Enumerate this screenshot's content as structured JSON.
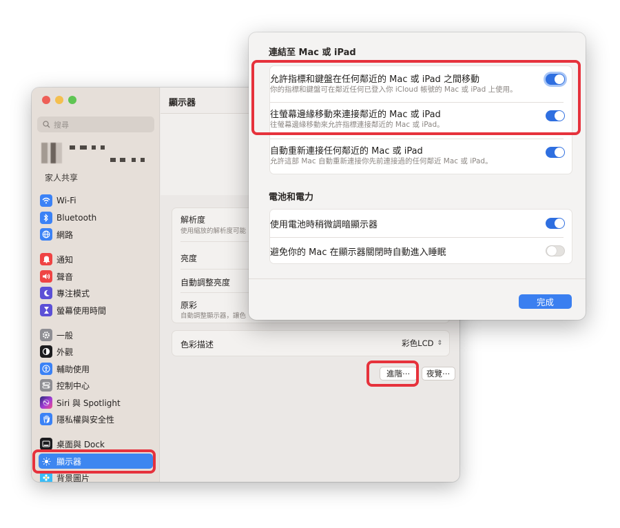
{
  "window": {
    "title": "顯示器",
    "search_placeholder": "搜尋",
    "family_label": "家人共享",
    "sidebar": [
      {
        "label": "Wi-Fi",
        "icon": "wifi-icon",
        "color": "#3b82f6"
      },
      {
        "label": "Bluetooth",
        "icon": "bluetooth-icon",
        "color": "#3b82f6"
      },
      {
        "label": "網路",
        "icon": "globe-icon",
        "color": "#3b82f6"
      },
      {
        "label": "通知",
        "icon": "bell-icon",
        "color": "#ef4444"
      },
      {
        "label": "聲音",
        "icon": "speaker-icon",
        "color": "#ef4444"
      },
      {
        "label": "專注模式",
        "icon": "moon-icon",
        "color": "#5b50d6"
      },
      {
        "label": "螢幕使用時間",
        "icon": "hourglass-icon",
        "color": "#5b50d6"
      },
      {
        "label": "一般",
        "icon": "gear-icon",
        "color": "#8e8e93"
      },
      {
        "label": "外觀",
        "icon": "appearance-icon",
        "color": "#1c1c1e"
      },
      {
        "label": "輔助使用",
        "icon": "accessibility-icon",
        "color": "#3b82f6"
      },
      {
        "label": "控制中心",
        "icon": "control-center-icon",
        "color": "#8e8e93"
      },
      {
        "label": "Siri 與 Spotlight",
        "icon": "siri-icon",
        "color": "#7c3aed"
      },
      {
        "label": "隱私權與安全性",
        "icon": "hand-icon",
        "color": "#3b82f6"
      },
      {
        "label": "桌面與 Dock",
        "icon": "dock-icon",
        "color": "#1c1c1e"
      },
      {
        "label": "顯示器",
        "icon": "sun-icon",
        "color": "#3b82f6",
        "selected": true
      },
      {
        "label": "背景圖片",
        "icon": "wallpaper-icon",
        "color": "#38bdf8"
      }
    ],
    "settings": {
      "resolution_label": "解析度",
      "resolution_sub": "使用縮放的解析度可能",
      "brightness_label": "亮度",
      "auto_brightness_label": "自動調整亮度",
      "true_tone_label": "原彩",
      "true_tone_sub": "自動調整顯示器，讓色",
      "color_profile_label": "色彩描述",
      "color_profile_value": "彩色LCD",
      "advanced_button": "進階⋯",
      "night_shift_button": "夜覽⋯"
    }
  },
  "sheet": {
    "section1_title": "連結至 Mac 或 iPad",
    "options1": [
      {
        "label": "允許指標和鍵盤在任何鄰近的 Mac 或 iPad 之間移動",
        "sub": "你的指標和鍵盤可在鄰近任何已登入你 iCloud 帳號的 Mac 或 iPad 上使用。",
        "on": true
      },
      {
        "label": "往螢幕邊緣移動來連接鄰近的 Mac 或 iPad",
        "sub": "往螢幕邊緣移動來允許指標連接鄰近的 Mac 或 iPad。",
        "on": true
      },
      {
        "label": "自動重新連接任何鄰近的 Mac 或 iPad",
        "sub": "允許這部 Mac 自動重新連接你先前連接過的任何鄰近 Mac 或 iPad。",
        "on": true
      }
    ],
    "section2_title": "電池和電力",
    "options2": [
      {
        "label": "使用電池時稍微調暗顯示器",
        "on": true
      },
      {
        "label": "避免你的 Mac 在顯示器關閉時自動進入睡眠",
        "on": false
      }
    ],
    "done_button": "完成"
  },
  "colors": {
    "highlight": "#e6323c",
    "accent": "#3a7ff0"
  }
}
